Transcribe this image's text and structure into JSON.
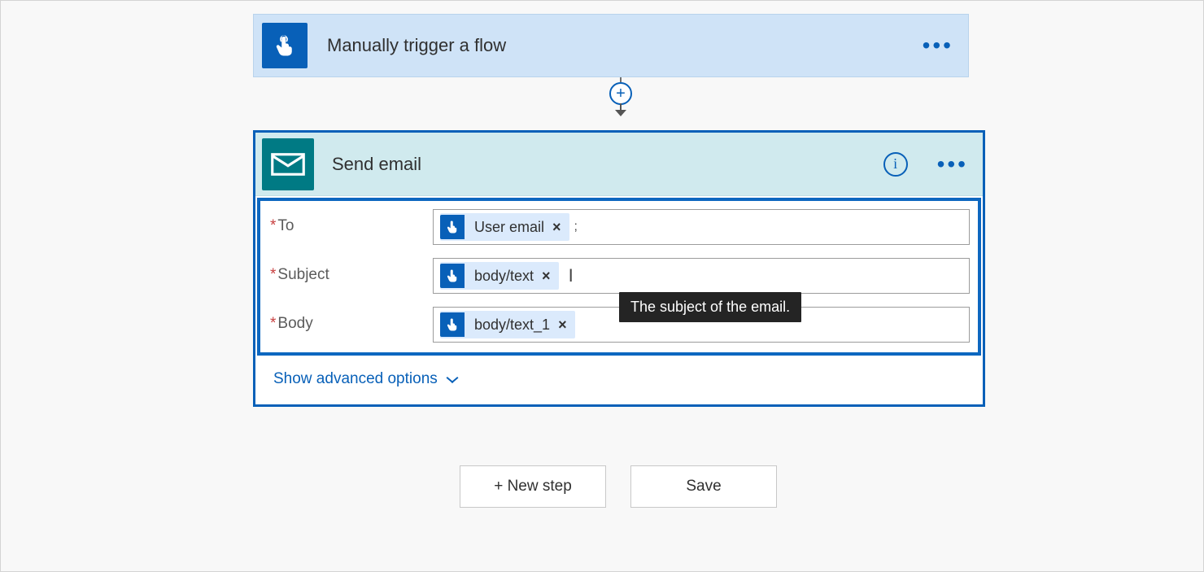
{
  "trigger": {
    "title": "Manually trigger a flow"
  },
  "action": {
    "title": "Send email",
    "fields": {
      "to": {
        "label": "To",
        "token_label": "User email",
        "after_semicolon": ";"
      },
      "subject": {
        "label": "Subject",
        "token_label": "body/text"
      },
      "body": {
        "label": "Body",
        "token_label": "body/text_1"
      }
    },
    "advanced_label": "Show advanced options",
    "tooltip_subject": "The subject of the email."
  },
  "footer": {
    "new_step_label": "+ New step",
    "save_label": "Save"
  }
}
